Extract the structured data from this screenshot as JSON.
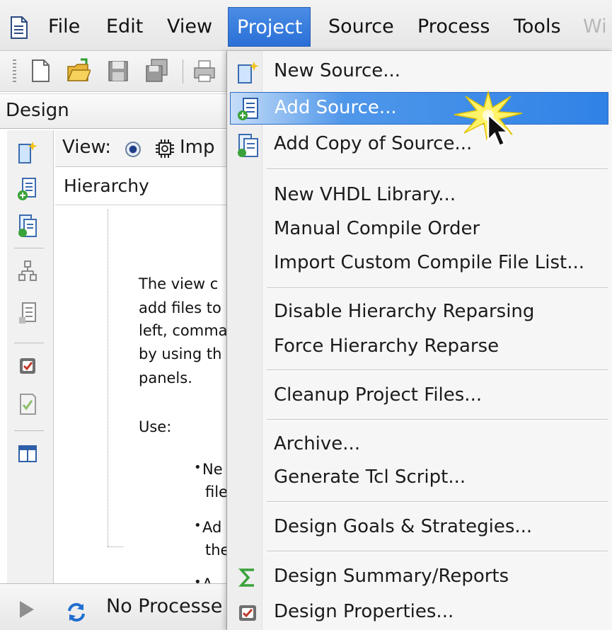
{
  "menubar": {
    "items": [
      {
        "label": "File"
      },
      {
        "label": "Edit"
      },
      {
        "label": "View"
      },
      {
        "label": "Project"
      },
      {
        "label": "Source"
      },
      {
        "label": "Process"
      },
      {
        "label": "Tools"
      },
      {
        "label": "Wi"
      }
    ],
    "active": "Project"
  },
  "toolbar": {
    "icons": [
      "new-file-icon",
      "open-folder-icon",
      "save-icon",
      "save-all-icon",
      "print-icon"
    ]
  },
  "design_panel": {
    "tab_label": "Design",
    "view_label": "View:",
    "view_value": "Imp",
    "hierarchy_label": "Hierarchy",
    "help_lines": [
      "The view c",
      "add files to",
      "left, comma",
      "by using th",
      "panels."
    ],
    "use_label": "Use:",
    "bullets": [
      {
        "line1": "Ne",
        "line2": "file"
      },
      {
        "line1": "Ad",
        "line2": "the"
      },
      {
        "line1": "A",
        "line2": ""
      }
    ],
    "left_icons": [
      "new-source-icon",
      "add-source-icon",
      "add-copy-source-icon",
      "hierarchy-icon",
      "view-source-icon",
      "properties-icon",
      "checklist-icon",
      "table-icon"
    ]
  },
  "process_bar": {
    "text": "No Processe"
  },
  "project_menu": {
    "items": [
      {
        "label": "New Source...",
        "icon": "new-source-icon"
      },
      {
        "label": "Add Source...",
        "icon": "add-source-icon",
        "highlighted": true
      },
      {
        "label": "Add Copy of Source...",
        "icon": "add-copy-source-icon"
      },
      {
        "label": "New VHDL Library...",
        "icon": ""
      },
      {
        "label": "Manual Compile Order",
        "icon": ""
      },
      {
        "label": "Import Custom Compile File List...",
        "icon": ""
      },
      {
        "label": "Disable Hierarchy Reparsing",
        "icon": ""
      },
      {
        "label": "Force Hierarchy Reparse",
        "icon": ""
      },
      {
        "label": "Cleanup Project Files...",
        "icon": ""
      },
      {
        "label": "Archive...",
        "icon": ""
      },
      {
        "label": "Generate Tcl Script...",
        "icon": ""
      },
      {
        "label": "Design Goals & Strategies...",
        "icon": ""
      },
      {
        "label": "Design Summary/Reports",
        "icon": "sigma-icon"
      },
      {
        "label": "Design Properties...",
        "icon": "design-properties-icon"
      }
    ]
  },
  "colors": {
    "highlight": "#2f82e6",
    "active_menu": "#2a6fd6",
    "menu_bg": "#f6f6f6"
  }
}
